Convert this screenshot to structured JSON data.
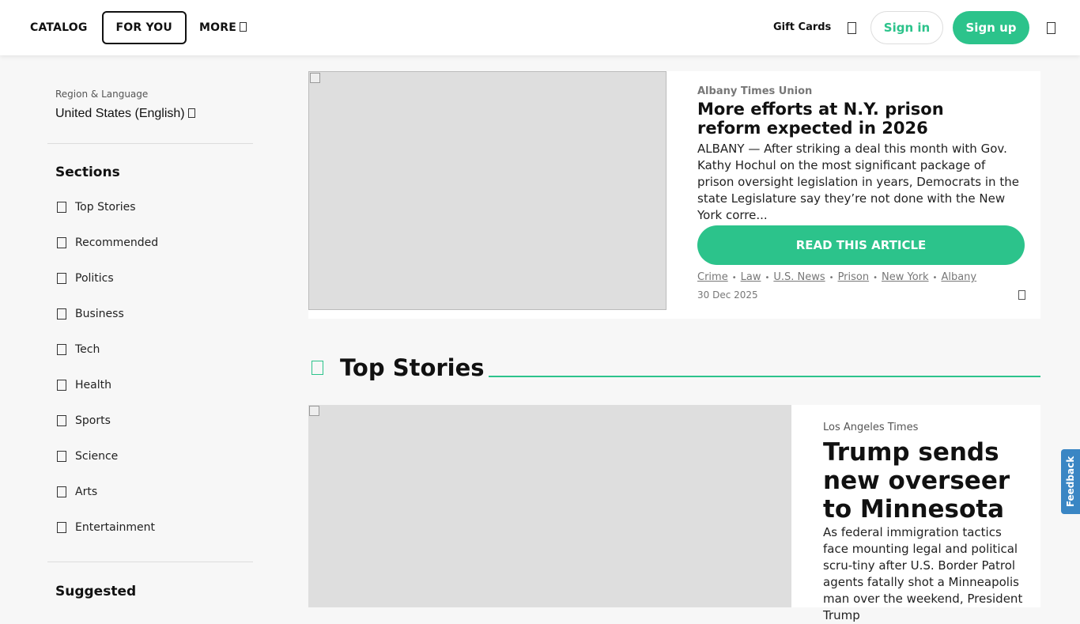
{
  "nav": {
    "catalog": "CATALOG",
    "for_you": "FOR YOU",
    "more": "MORE",
    "gift_cards": "Gift Cards",
    "sign_in": "Sign in",
    "sign_up": "Sign up",
    "icons": {
      "more": "chevron-down-icon",
      "search": "search-icon",
      "menu": "menu-icon"
    }
  },
  "sidebar": {
    "region_label": "Region & Language",
    "region_value": "United States (English)",
    "sections_title": "Sections",
    "sections": [
      {
        "label": "Top Stories"
      },
      {
        "label": "Recommended"
      },
      {
        "label": "Politics"
      },
      {
        "label": "Business"
      },
      {
        "label": "Tech"
      },
      {
        "label": "Health"
      },
      {
        "label": "Sports"
      },
      {
        "label": "Science"
      },
      {
        "label": "Arts"
      },
      {
        "label": "Entertainment"
      }
    ],
    "suggested_title": "Suggested"
  },
  "featured_article": {
    "source": "Albany Times Union",
    "title": "More efforts at N.Y. prison reform expected in 2026",
    "description": "ALBANY — After striking a deal this month with Gov. Kathy Hochul on the most significant package of prison oversight legislation in years, Democrats in the state Legislature say they’re not done with the New York corre...",
    "read_button": "READ THIS ARTICLE",
    "tags": [
      "Crime",
      "Law",
      "U.S. News",
      "Prison",
      "New York",
      "Albany"
    ],
    "date": "30 Dec 2025"
  },
  "top_stories": {
    "heading": "Top Stories",
    "article": {
      "source_logo_alt": "Los Angeles Times",
      "title": "Trump sends new overseer to Minnesota",
      "description": "As federal immigration tactics face mounting legal and political scru-tiny after U.S. Border Patrol agents fatally shot a Minneapolis man over the weekend, President Trump"
    }
  },
  "feedback": "Feedback",
  "colors": {
    "accent": "#2cc38b",
    "feedback": "#3a86c4",
    "background": "#f7f7f7"
  }
}
